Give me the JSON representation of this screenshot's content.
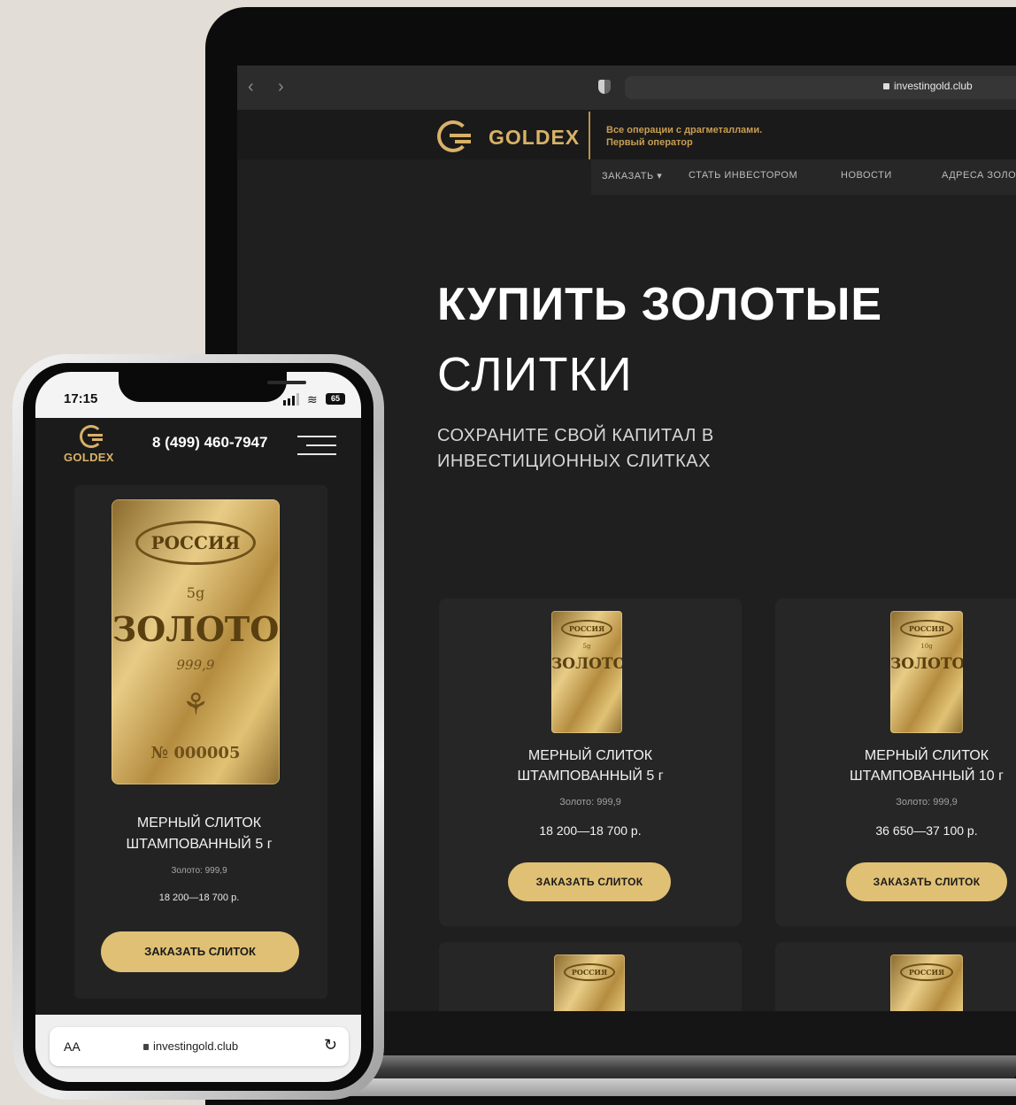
{
  "colors": {
    "gold": "#d8b267",
    "button": "#e0c074",
    "dark": "#1f1f1f",
    "accent_arc": "#d9b07f"
  },
  "desktop": {
    "browser": {
      "back_icon": "chevron-left-icon",
      "forward_icon": "chevron-right-icon",
      "url": "investingold.club"
    },
    "header": {
      "logo": "GOLDEX",
      "tagline_line1": "Все операции с драгметаллами.",
      "tagline_line2": "Первый оператор"
    },
    "menu": [
      "ЗАКАЗАТЬ ▾",
      "СТАТЬ ИНВЕСТОРОМ",
      "НОВОСТИ",
      "АДРЕСА ЗОЛО"
    ],
    "hero": {
      "title_bold": "КУПИТЬ ЗОЛОТЫЕ",
      "title_light": "СЛИТКИ",
      "subtitle": "СОХРАНИТЕ СВОЙ КАПИТАЛ В ИНВЕСТИЦИОННЫХ СЛИТКАХ"
    },
    "products": [
      {
        "title_line1": "МЕРНЫЙ СЛИТОК",
        "title_line2": "ШТАМПОВАННЫЙ 5 г",
        "purity": "Золото: 999,9",
        "price": "18 200—18 700 р.",
        "button": "ЗАКАЗАТЬ СЛИТОК",
        "bar_oval": "РОССИЯ",
        "bar_weight": "5g",
        "bar_word": "ЗОЛОТО"
      },
      {
        "title_line1": "МЕРНЫЙ СЛИТОК",
        "title_line2": "ШТАМПОВАННЫЙ 10 г",
        "purity": "Золото: 999,9",
        "price": "36 650—37 100 р.",
        "button": "ЗАКАЗАТЬ СЛИТОК",
        "bar_oval": "РОССИЯ",
        "bar_weight": "10g",
        "bar_word": "ЗОЛОТО"
      }
    ],
    "more_bars": [
      "РОССИЯ",
      "РОССИЯ"
    ]
  },
  "mobile": {
    "status": {
      "time": "17:15",
      "battery": "65"
    },
    "logo": "GOLDEX",
    "phone_number": "8 (499) 460-7947",
    "product": {
      "bar_oval": "РОССИЯ",
      "bar_weight": "5g",
      "bar_word": "ЗОЛОТО",
      "bar_purity": "999,9",
      "bar_serial": "№ 000005",
      "title_line1": "МЕРНЫЙ СЛИТОК",
      "title_line2": "ШТАМПОВАННЫЙ 5 г",
      "purity": "Золото: 999,9",
      "price": "18 200—18 700 р.",
      "button": "ЗАКАЗАТЬ СЛИТОК"
    },
    "browser": {
      "text_size": "AA",
      "url": "investingold.club"
    }
  }
}
